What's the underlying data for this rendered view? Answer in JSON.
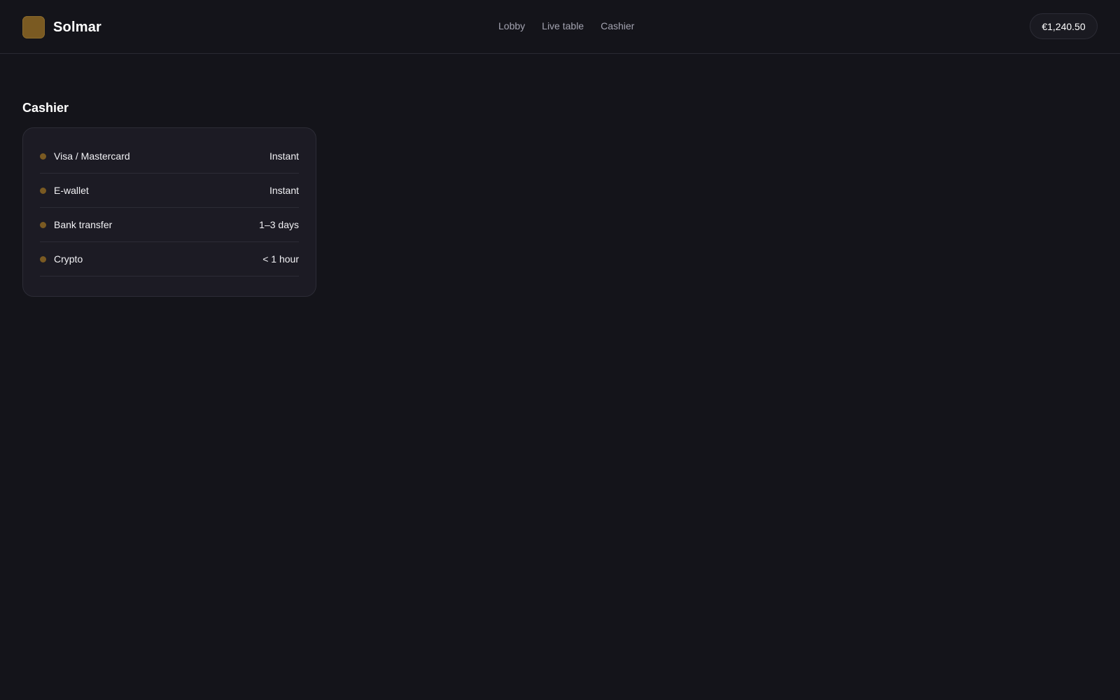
{
  "header": {
    "brand_name": "Solmar",
    "logo_color": "#7a5a22",
    "nav": [
      "Lobby",
      "Live table",
      "Cashier"
    ],
    "balance": "€1,240.50"
  },
  "main": {
    "title": "Cashier",
    "methods": [
      {
        "label": "Visa / Mastercard",
        "time": "Instant"
      },
      {
        "label": "E-wallet",
        "time": "Instant"
      },
      {
        "label": "Bank transfer",
        "time": "1–3 days"
      },
      {
        "label": "Crypto",
        "time": "< 1 hour"
      }
    ]
  },
  "colors": {
    "background": "#14141a",
    "card": "#1c1b24",
    "accent": "#7a5a22"
  }
}
